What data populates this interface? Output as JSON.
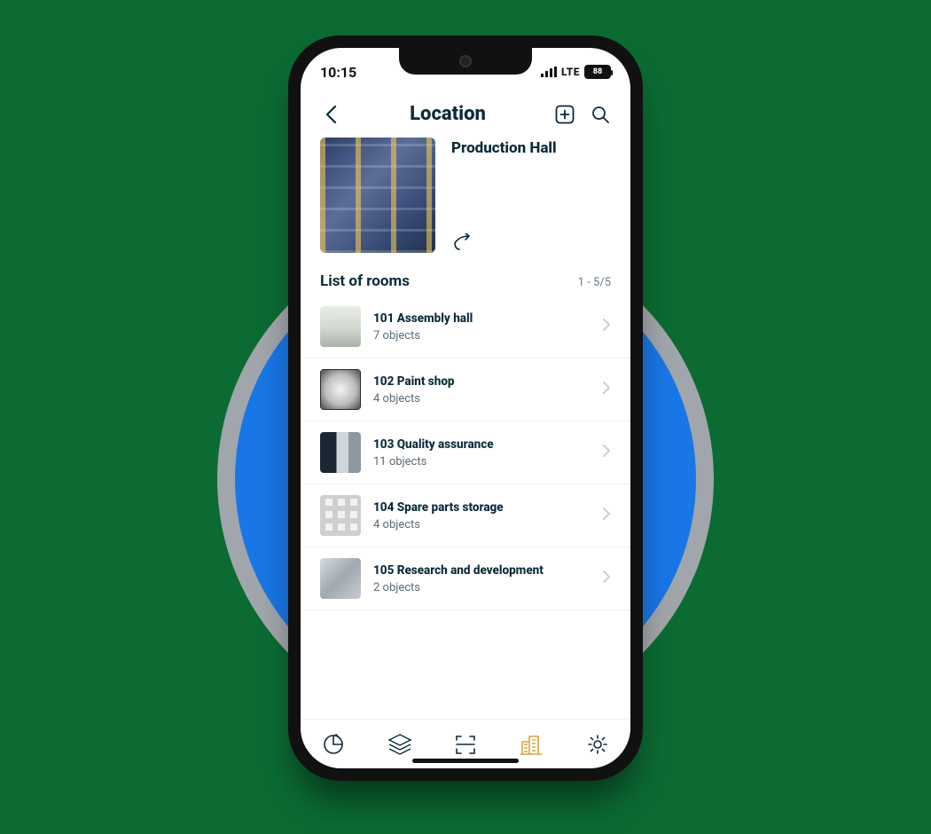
{
  "status": {
    "time": "10:15",
    "network": "LTE",
    "battery": "88"
  },
  "nav": {
    "title": "Location"
  },
  "hero": {
    "title": "Production Hall"
  },
  "section": {
    "title": "List of rooms",
    "range": "1 - 5/5"
  },
  "rooms": [
    {
      "title": "101 Assembly hall",
      "sub": "7 objects",
      "img": "hall"
    },
    {
      "title": "102 Paint shop",
      "sub": "4 objects",
      "img": "paint"
    },
    {
      "title": "103 Quality assurance",
      "sub": "11 objects",
      "img": "qa"
    },
    {
      "title": "104 Spare parts storage",
      "sub": "4 objects",
      "img": "storage"
    },
    {
      "title": "105 Research and development",
      "sub": "2 objects",
      "img": "rd"
    }
  ],
  "tabs": [
    {
      "name": "dashboard",
      "active": false
    },
    {
      "name": "layers",
      "active": false
    },
    {
      "name": "scan",
      "active": false
    },
    {
      "name": "locations",
      "active": true
    },
    {
      "name": "settings",
      "active": false
    }
  ]
}
